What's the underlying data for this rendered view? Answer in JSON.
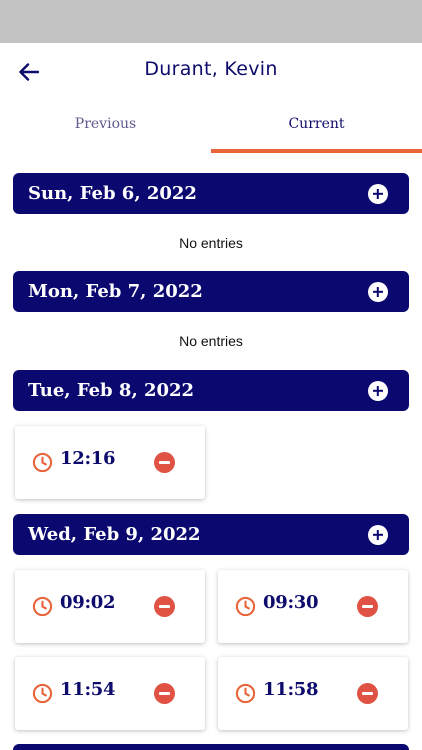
{
  "header": {
    "title": "Durant, Kevin",
    "back_icon": "arrow-left-icon"
  },
  "tabs": [
    {
      "label": "Previous",
      "active": false
    },
    {
      "label": "Current",
      "active": true
    }
  ],
  "colors": {
    "primary": "#0b0870",
    "accent": "#e8643a",
    "remove": "#e05344",
    "status_bar": "#c4c4c4"
  },
  "days": [
    {
      "title": "Sun, Feb 6, 2022",
      "empty_text": "No entries",
      "entries": []
    },
    {
      "title": "Mon, Feb 7, 2022",
      "empty_text": "No entries",
      "entries": []
    },
    {
      "title": "Tue, Feb 8, 2022",
      "entries": [
        {
          "time": "12:16"
        }
      ]
    },
    {
      "title": "Wed, Feb 9, 2022",
      "entries": [
        {
          "time": "09:02"
        },
        {
          "time": "09:30"
        },
        {
          "time": "11:54"
        },
        {
          "time": "11:58"
        }
      ]
    }
  ],
  "icons": {
    "add": "plus-circle-icon",
    "remove": "minus-circle-icon",
    "entry": "clock-icon"
  }
}
